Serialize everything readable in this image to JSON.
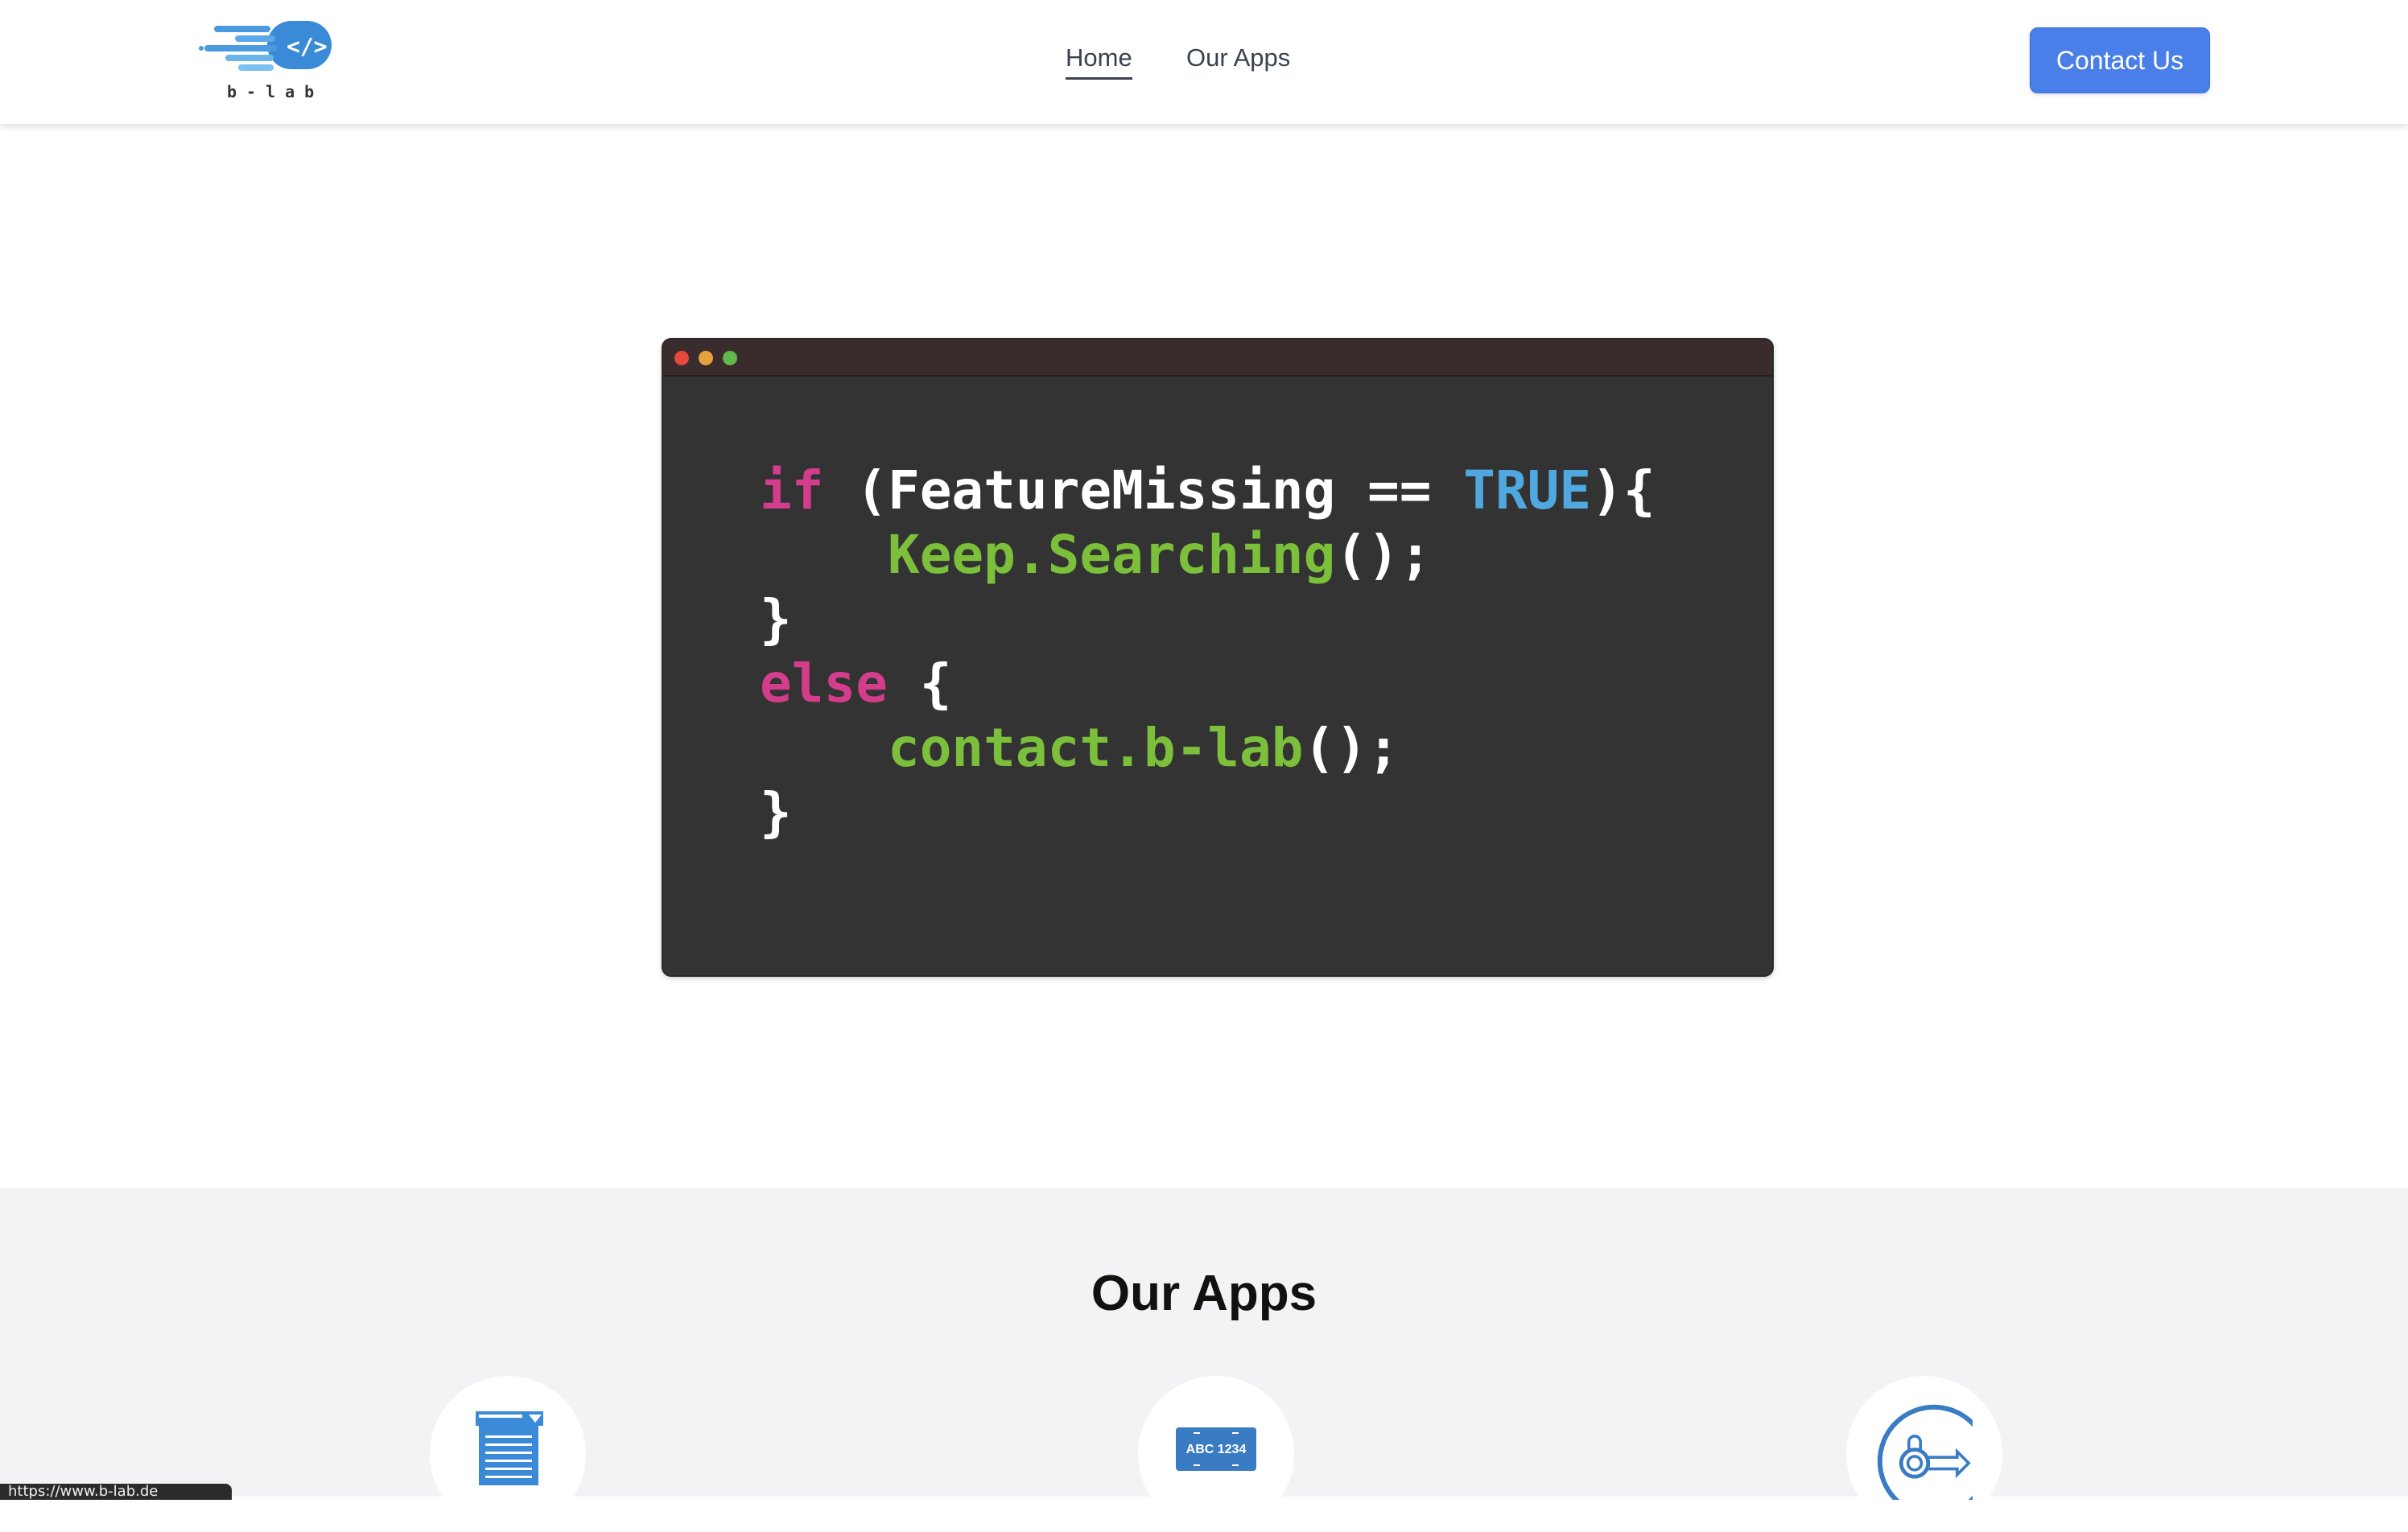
{
  "header": {
    "logo_text": "b-lab",
    "nav": [
      {
        "label": "Home"
      },
      {
        "label": "Our Apps"
      }
    ],
    "contact_label": "Contact Us"
  },
  "hero": {
    "code": {
      "line1": {
        "kw": "if",
        "text1": " (FeatureMissing == ",
        "bool": "TRUE",
        "text2": "){"
      },
      "line2": {
        "indent": "    ",
        "fn": "Keep.Searching",
        "text": "();"
      },
      "line3": {
        "text": "}"
      },
      "line4": {
        "kw": "else",
        "text": " {"
      },
      "line5": {
        "indent": "    ",
        "fn": "contact.b-lab",
        "text": "();"
      },
      "line6": {
        "text": "}"
      }
    }
  },
  "apps": {
    "title": "Our Apps",
    "items": [
      {
        "icon": "notepad-icon"
      },
      {
        "icon": "license-plate-icon",
        "plate_text": "ABC  1234"
      },
      {
        "icon": "speed-key-icon"
      }
    ]
  },
  "status_bar": {
    "url": "https://www.b-lab.de"
  },
  "colors": {
    "accent": "#4a7ee8",
    "keyword": "#d33d8c",
    "function": "#7bbf3b",
    "boolean": "#4fa8e0",
    "code_bg": "#333333"
  }
}
